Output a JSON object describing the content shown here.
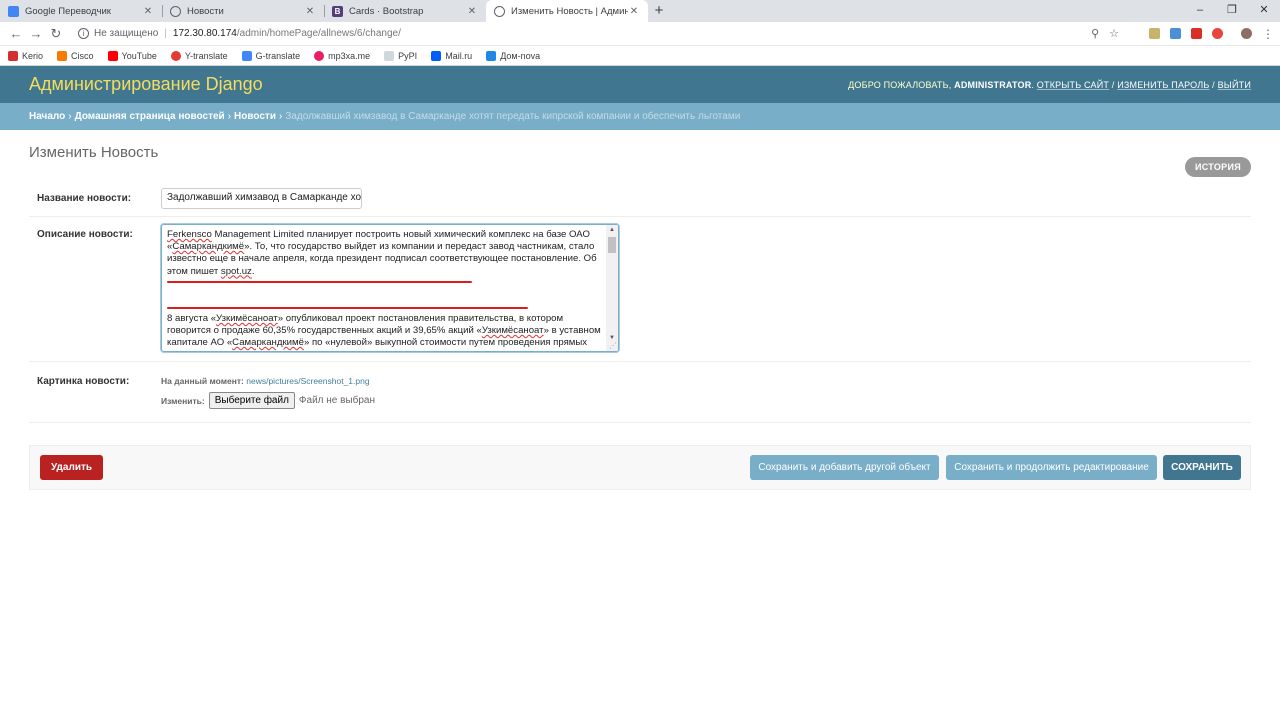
{
  "browser": {
    "tabs": [
      {
        "title": "Google Переводчик",
        "icon": "google-translate-icon"
      },
      {
        "title": "Новости",
        "icon": "globe-icon"
      },
      {
        "title": "Cards · Bootstrap",
        "icon": "bootstrap-icon"
      },
      {
        "title": "Изменить Новость | Администр",
        "icon": "globe-icon",
        "active": true
      }
    ],
    "new_tab": "+",
    "window_controls": [
      "–",
      "❐",
      "✕"
    ],
    "address": {
      "security": "Не защищено",
      "host": "172.30.80.174",
      "path": "/admin/homePage/allnews/6/change/"
    },
    "bookmarks": [
      "Kerio",
      "Cisco",
      "YouTube",
      "Y-translate",
      "G-translate",
      "mp3xa.me",
      "PyPI",
      "Mail.ru",
      "Дом-nova"
    ]
  },
  "header": {
    "branding": "Администрирование Django",
    "welcome": "ДОБРО ПОЖАЛОВАТЬ,",
    "username": "ADMINISTRATOR",
    "view_site": "ОТКРЫТЬ САЙТ",
    "change_password": "ИЗМЕНИТЬ ПАРОЛЬ",
    "logout": "ВЫЙТИ"
  },
  "breadcrumbs": {
    "home": "Начало",
    "app": "Домашняя страница новостей",
    "model": "Новости",
    "current": "Задолжавший химзавод в Самарканде хотят передать кипрской компании и обеспечить льготами"
  },
  "page": {
    "title": "Изменить Новость",
    "history": "ИСТОРИЯ"
  },
  "form": {
    "title_label": "Название новости:",
    "title_value": "Задолжавший химзавод в Самарканде хот",
    "description_label": "Описание новости:",
    "description": {
      "p1": {
        "w1": "Ferkensco",
        "t1": " Management Limited планирует построить новый химический комплекс на базе ОАО «",
        "w2": "Самаркандкимё",
        "t2": "». То, что государство выйдет из компании и передаст завод частникам, стало известно еще в начале апреля, когда президент подписал соответствующее постановление. Об этом пишет ",
        "w3": "spot.uz",
        "t3": "."
      },
      "p2": {
        "t1": "8 августа «",
        "w1": "Узкимёсаноат",
        "t2": "» опубликовал проект постановления правительства, в котором говорится о продаже 60,35% государственных акций и 39,65% акций «",
        "w2": "Узкимёсаноат",
        "t3": "» в уставном капитале АО «",
        "w3": "Самаркандкимё",
        "t4": "» по «нулевой» выкупной стоимости путем проведения прямых"
      }
    },
    "image_label": "Картинка новости:",
    "current_label": "На данный момент:",
    "current_file": "news/pictures/Screenshot_1.png",
    "change_label": "Изменить:",
    "choose_file": "Выберите файл",
    "no_file": "Файл не выбран"
  },
  "actions": {
    "delete": "Удалить",
    "save_add_another": "Сохранить и добавить другой объект",
    "save_continue": "Сохранить и продолжить редактирование",
    "save": "СОХРАНИТЬ"
  },
  "colors": {
    "header_bg": "#417690",
    "branding": "#f5dd5d",
    "breadcrumbs_bg": "#79aec8",
    "delete_bg": "#ba2121",
    "annotation_red": "#e01d1d"
  }
}
